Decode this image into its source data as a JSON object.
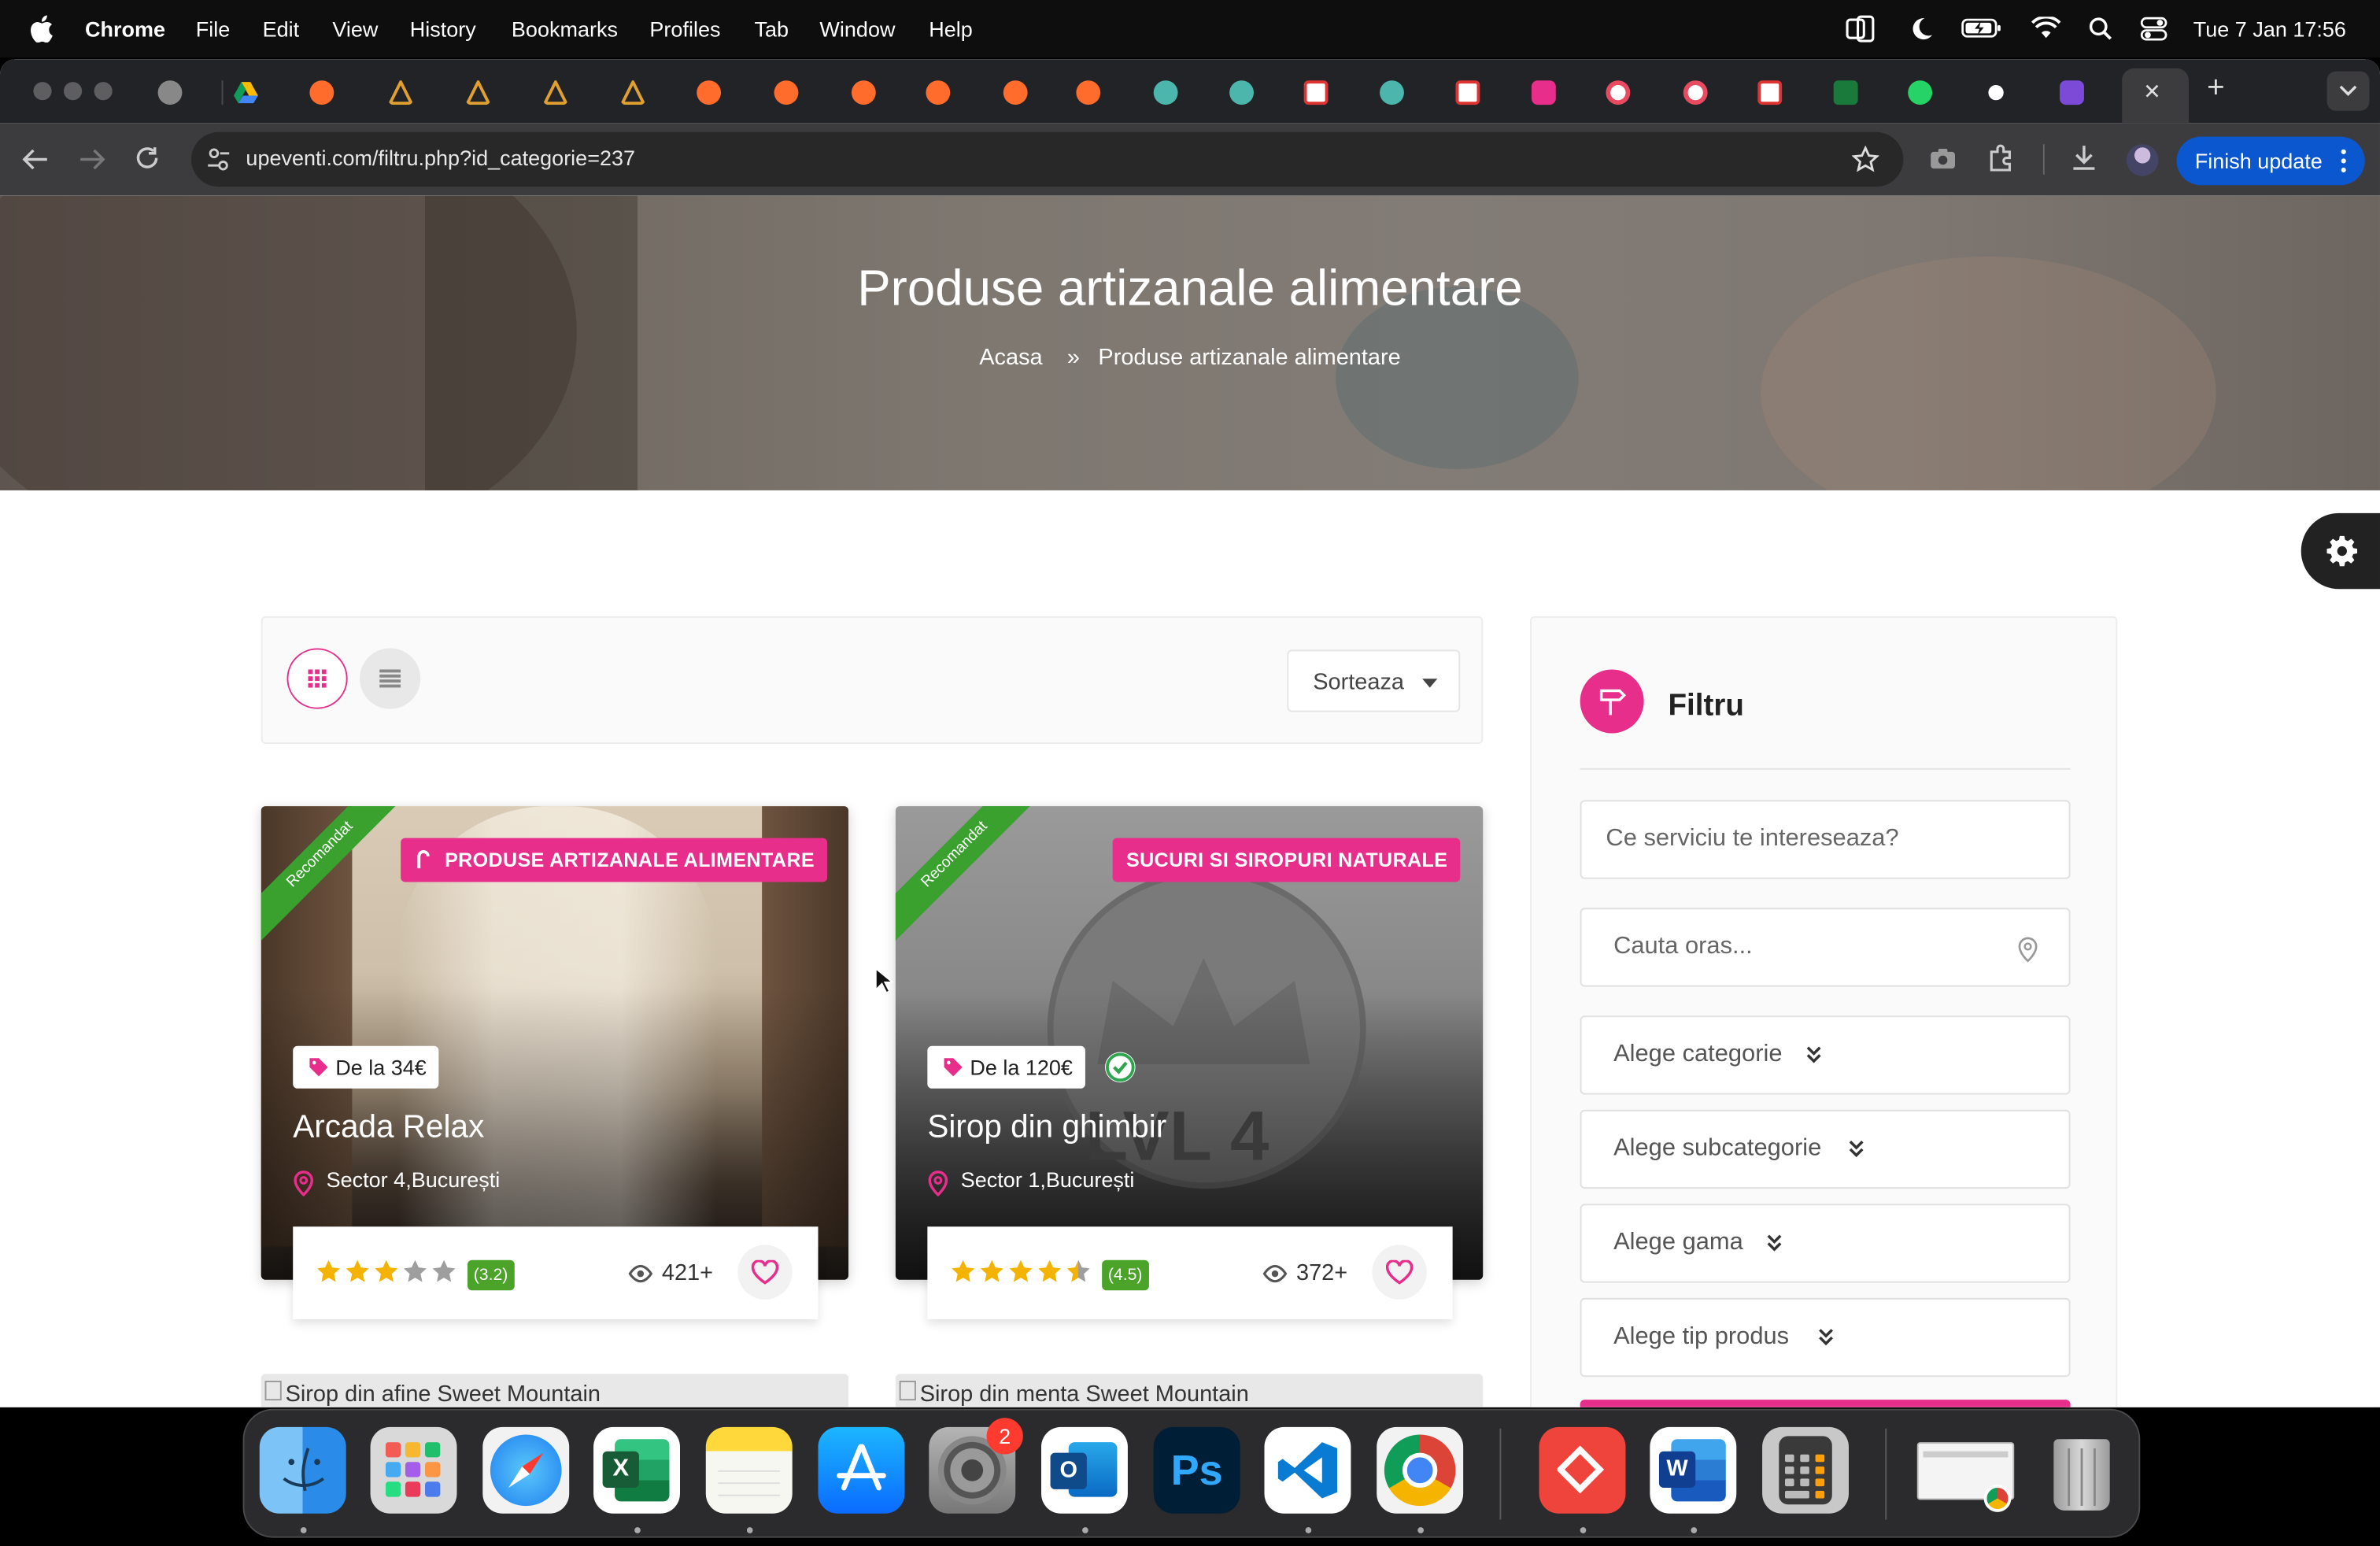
{
  "menubar": {
    "app_name": "Chrome",
    "items": [
      "File",
      "Edit",
      "View",
      "History",
      "Bookmarks",
      "Profiles",
      "Tab",
      "Window",
      "Help"
    ],
    "clock": "Tue 7 Jan  17:56"
  },
  "browser": {
    "url": "upeventi.com/filtru.php?id_categorie=237",
    "finish_update": "Finish update",
    "new_tab": "+",
    "close_tab": "✕"
  },
  "hero": {
    "title": "Produse artizanale alimentare",
    "breadcrumb_home": "Acasa",
    "breadcrumb_sep": "»",
    "breadcrumb_current": "Produse artizanale alimentare"
  },
  "toolbar": {
    "sort_label": "Sorteaza"
  },
  "cards": [
    {
      "ribbon": "Recomandat",
      "category": "PRODUSE ARTIZANALE ALIMENTARE",
      "price": "De la 34€",
      "title": "Arcada Relax",
      "location": "Sector 4,București",
      "stars": 3,
      "rating": "(3.2)",
      "views": "421+"
    },
    {
      "ribbon": "Recomandat",
      "category": "SUCURI SI SIROPURI NATURALE",
      "price": "De la 120€",
      "title": "Sirop din ghimbir",
      "location": "Sector 1,București",
      "stars": 4.5,
      "rating": "(4.5)",
      "views": "372+",
      "image_text": "LVL 4"
    }
  ],
  "partial_cards": [
    "Sirop din afine Sweet Mountain",
    "Sirop din menta Sweet Mountain"
  ],
  "filter": {
    "title": "Filtru",
    "service_placeholder": "Ce serviciu te intereseaza?",
    "city_placeholder": "Cauta oras...",
    "dropdowns": [
      "Alege categorie",
      "Alege subcategorie",
      "Alege gama",
      "Alege tip produs"
    ]
  },
  "dock": {
    "badge": "2",
    "apps": [
      "finder-icon",
      "launchpad-icon",
      "safari-icon",
      "excel-icon",
      "notes-icon",
      "app-store-icon",
      "system-settings-icon",
      "outlook-icon",
      "photoshop-icon",
      "vscode-icon",
      "chrome-icon",
      "anydesk-icon",
      "word-icon",
      "calculator-icon",
      "preview-window-icon",
      "trash-icon"
    ]
  },
  "colors": {
    "accent": "#e62e8a",
    "ribbon": "#3aa12f",
    "rating": "#4ca32a",
    "star": "#f5b301",
    "finish_update": "#0b57d0"
  }
}
